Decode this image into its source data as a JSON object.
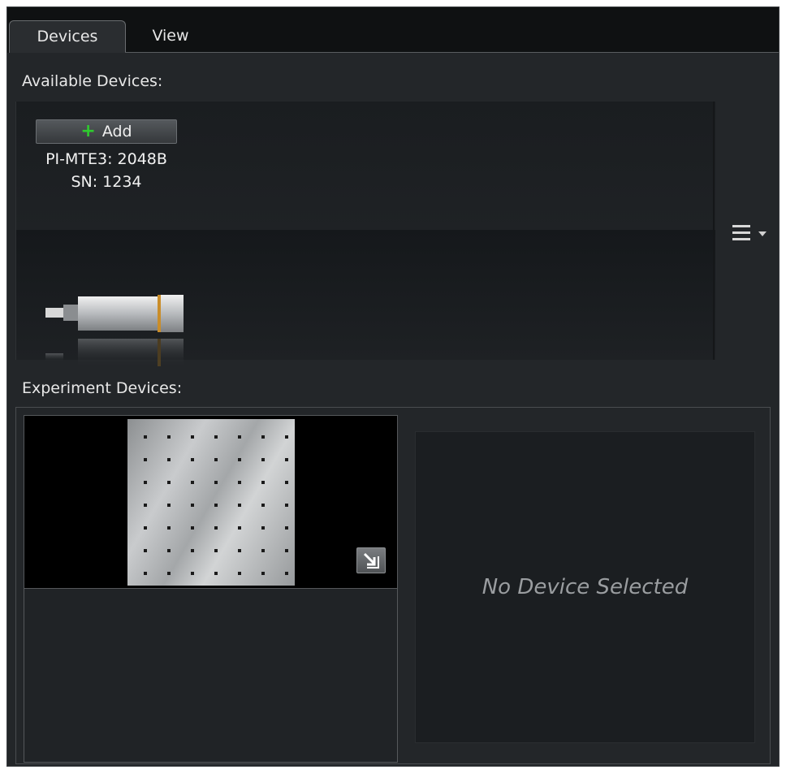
{
  "tabs": [
    {
      "label": "Devices",
      "active": true
    },
    {
      "label": "View",
      "active": false
    }
  ],
  "available": {
    "label": "Available Devices:",
    "add_label": "Add",
    "device_model": "PI-MTE3: 2048B",
    "device_serial": "SN: 1234"
  },
  "experiment": {
    "label": "Experiment Devices:",
    "empty_message": "No Device Selected"
  },
  "icons": {
    "add": "plus-icon",
    "menu": "hamburger-menu-icon",
    "camera": "camera-device-icon",
    "expand": "expand-arrow-icon"
  },
  "colors": {
    "background": "#232629",
    "tabbar": "#0f1112",
    "plus": "#2ecc2e",
    "text": "#e6e6e6",
    "muted_text": "#9a9da0"
  }
}
